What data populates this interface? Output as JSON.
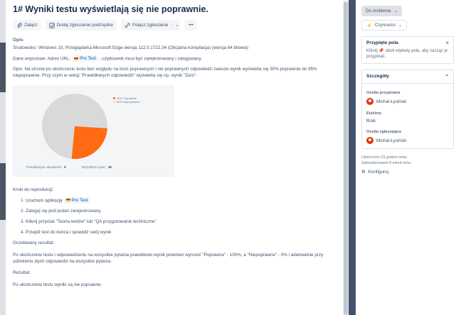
{
  "issue": {
    "title": "1# Wyniki testu wyświetlają się nie poprawnie."
  },
  "toolbar": {
    "attach": "Załącz",
    "add_subtask": "Dodaj zgłoszenie podrzędne",
    "link_issue": "Połącz zgłoszenie",
    "more": "•••"
  },
  "description": {
    "heading": "Opis",
    "env": "Środowisko: Windows 10, Przeglądarka Microsoft Edge wersja 112.0.1722.34 (Oficjalna kompilacja) (wersja 64 bitowa)",
    "input_prefix": "Dane wejściowe: Adres URL:",
    "link_text": "Pro Test",
    "input_suffix": ", użytkownik musi być zarejestrowany i zalogowany.",
    "body": "Opis: Na stronie po ukończeniu testu bez względu na ilość poprawnych i nie poprawnych odpowiedzi zawsze wynik wyświetla się 30% poprawnie do 95% niepoprawnie. Przy czym w sekcji \"Prawidłowych odpowiedzi\" wyświetla się np. wynik \"Zero\"."
  },
  "screenshot": {
    "legend": [
      "30% Poprawnie",
      "65% Niepoprawne"
    ],
    "colors": {
      "correct": "#ff6a13",
      "incorrect": "#d9d9d9"
    },
    "stat1_label": "Prawidłowych odpowiedzi",
    "stat1_value": "0",
    "stat2_label": "Wszystkich pytań",
    "stat2_value": "10"
  },
  "steps": {
    "heading": "Kroki do reprodukcji:",
    "items": [
      {
        "prefix": "Uruchom aplikację",
        "link": "Pro Test"
      },
      {
        "text": "Zaloguj się jeśli jesteś zarejestrowany."
      },
      {
        "text": "Kliknij przycisk \"Teoria testów\" lub \"QA przygotowanie techniczne\""
      },
      {
        "text": "Przejdź test do końca i sprawdź swój wynik"
      }
    ]
  },
  "expected": {
    "heading": "Oczekiwany rezultat:",
    "text": " Po ukończeniu testu i odpowiedzeniu na wszystkie pytania prawidłowo wynik powinien wynosić \"Poprawne\" - 100%, a \"Niepoprawne\" - 0% i adekwatnie przy udzieleniu złych odpowiedzi na wszystkie pytania."
  },
  "result": {
    "heading": "Rezultat:",
    "text": "Po ukończeniu testu wyniki są nie poprawne."
  },
  "sidebar": {
    "status": "Do zrobienia",
    "actions": "Czynności",
    "pinned_title": "Przypięte pola",
    "pinned_text": "Kliknij 📌 obok etykiety pola, aby zacząć je przypinać.",
    "details_title": "Szczegóły",
    "assignee_label": "Osoba przypisana",
    "assignee": "Michał Łysiński",
    "labels_label": "Etykiety",
    "labels_value": "Brak",
    "reporter_label": "Osoba zgłaszająca",
    "reporter": "Michał Łysiński",
    "created": "Utworzono 19 godzin temu",
    "updated": "Zaktualizowano 8 minut temu",
    "configure": "Konfiguruj"
  }
}
